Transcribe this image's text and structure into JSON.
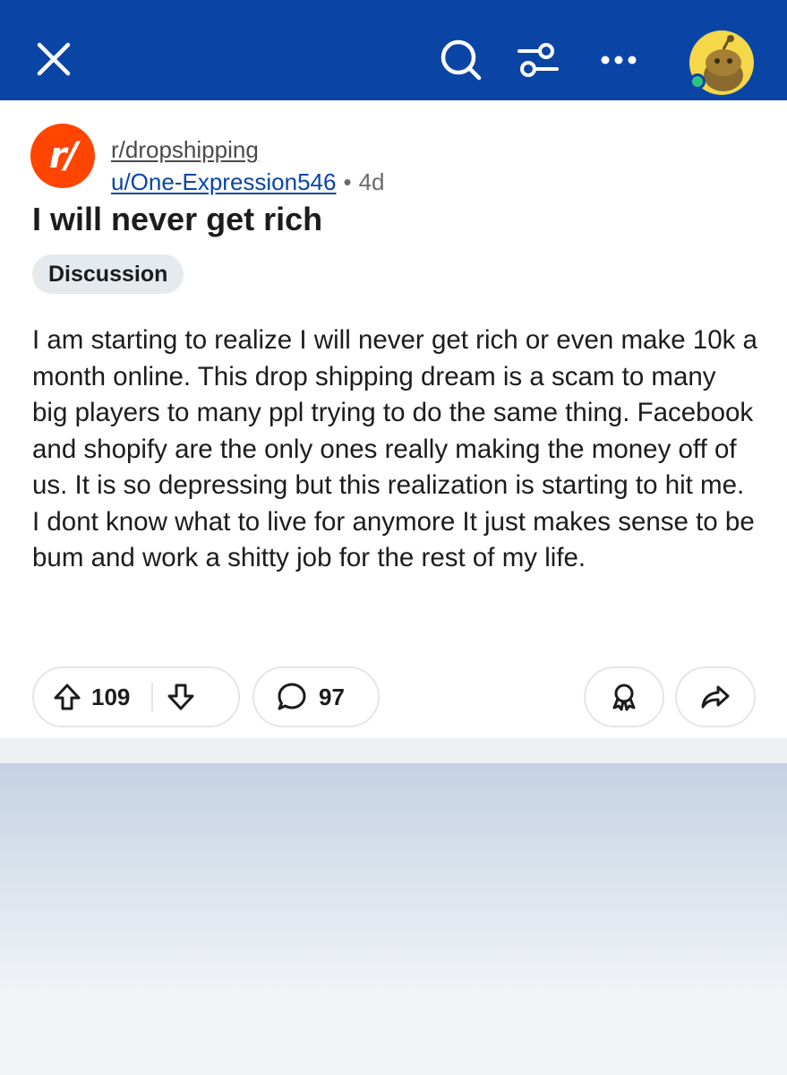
{
  "header": {
    "close_icon": "close-icon",
    "search_icon": "search-icon",
    "filter_icon": "filter-icon",
    "more_icon": "more-icon",
    "avatar_icon": "user-avatar",
    "background": "#0a45a6"
  },
  "post": {
    "subreddit_icon_text": "r/",
    "subreddit": "r/dropshipping",
    "author": "u/One-Expression546",
    "separator": "•",
    "age": "4d",
    "title": "I will never get rich",
    "flair": "Discussion",
    "body": "I am starting to realize I will never get rich or even make 10k a month online. This drop shipping dream is a scam to many big players to many ppl trying to do the same thing. Facebook and shopify are the only ones really making the money off of us. It is so depressing but this realization is starting to hit me. I dont know what to live for anymore It just makes sense to be bum and work a shitty job for the rest of my life.",
    "upvotes": "109",
    "comments": "97"
  },
  "colors": {
    "accent": "#0a45a6",
    "subreddit_icon": "#ff4500",
    "online": "#2ec27e"
  }
}
